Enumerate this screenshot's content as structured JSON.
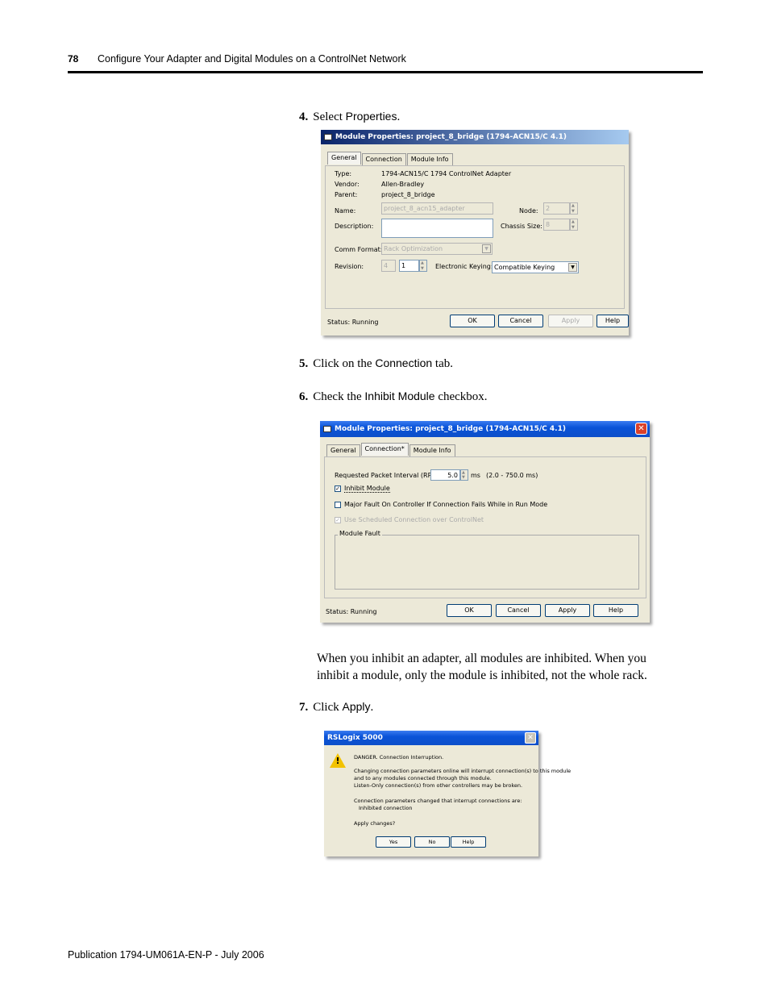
{
  "header": {
    "page_number": "78",
    "title": "Configure Your Adapter and Digital Modules on a ControlNet Network"
  },
  "steps": {
    "s4": {
      "num": "4.",
      "pre": "Select ",
      "ui": "Properties",
      "post": "."
    },
    "s5": {
      "num": "5.",
      "pre": "Click on the ",
      "ui": "Connection",
      "post": " tab."
    },
    "s6": {
      "num": "6.",
      "pre": "Check the ",
      "ui": "Inhibit Module",
      "post": " checkbox."
    },
    "s7": {
      "num": "7.",
      "pre": "Click ",
      "ui": "Apply",
      "post": "."
    }
  },
  "paragraph": "When you inhibit an adapter, all modules are inhibited. When you inhibit a module, only the module is inhibited, not the whole rack.",
  "dialog1": {
    "title": "Module Properties: project_8_bridge (1794-ACN15/C 4.1)",
    "tabs": [
      "General",
      "Connection",
      "Module Info"
    ],
    "type_label": "Type:",
    "type_value": "1794-ACN15/C 1794 ControlNet Adapter",
    "vendor_label": "Vendor:",
    "vendor_value": "Allen-Bradley",
    "parent_label": "Parent:",
    "parent_value": "project_8_bridge",
    "name_label": "Name:",
    "name_value": "project_8_acn15_adapter",
    "description_label": "Description:",
    "node_label": "Node:",
    "node_value": "2",
    "chassis_label": "Chassis Size:",
    "chassis_value": "8",
    "comm_label": "Comm Format:",
    "comm_value": "Rack Optimization",
    "revision_label": "Revision:",
    "rev_major": "4",
    "rev_minor": "1",
    "keying_label": "Electronic Keying:",
    "keying_value": "Compatible Keying",
    "status": "Status:  Running",
    "buttons": {
      "ok": "OK",
      "cancel": "Cancel",
      "apply": "Apply",
      "help": "Help"
    }
  },
  "dialog2": {
    "title": "Module Properties: project_8_bridge (1794-ACN15/C 4.1)",
    "tabs": [
      "General",
      "Connection*",
      "Module Info"
    ],
    "rpi_label": "Requested Packet Interval (RPI):",
    "rpi_value": "5.0",
    "rpi_unit": "ms",
    "rpi_range": "(2.0 - 750.0 ms)",
    "inhibit_label": "Inhibit Module",
    "major_fault_label": "Major Fault On Controller If Connection Fails While in Run Mode",
    "scheduled_label": "Use Scheduled Connection over ControlNet",
    "module_fault_label": "Module Fault",
    "status": "Status:  Running",
    "buttons": {
      "ok": "OK",
      "cancel": "Cancel",
      "apply": "Apply",
      "help": "Help"
    }
  },
  "dialog3": {
    "title": "RSLogix 5000",
    "line1": "DANGER. Connection Interruption.",
    "line2": "Changing connection parameters online will interrupt connection(s) to this module",
    "line3": "and to any modules connected through this module.",
    "line4": "Listen-Only connection(s) from other controllers may be broken.",
    "line5": "Connection parameters changed that interrupt connections are:",
    "line6": "Inhibited connection",
    "line7": "Apply changes?",
    "buttons": {
      "yes": "Yes",
      "no": "No",
      "help": "Help"
    }
  },
  "footer": "Publication 1794-UM061A-EN-P - July 2006"
}
